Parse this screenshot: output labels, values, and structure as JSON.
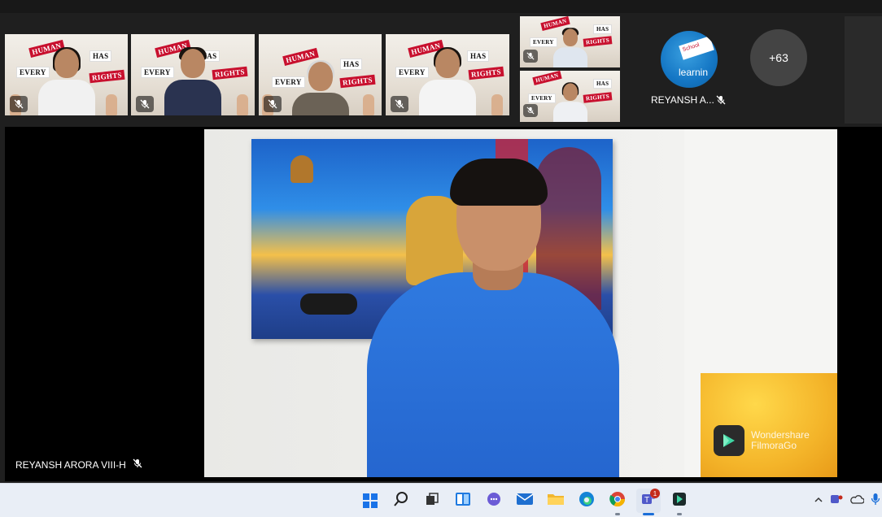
{
  "gallery": {
    "tiles": [
      {
        "sign_top": "HUMAN",
        "sign_mid": "HAS",
        "sign_left": "EVERY",
        "sign_right": "RIGHTS"
      },
      {
        "sign_top": "HUMAN",
        "sign_mid": "HAS",
        "sign_left": "EVERY",
        "sign_right": "RIGHTS"
      },
      {
        "sign_top": "HUMAN",
        "sign_mid": "HAS",
        "sign_left": "EVERY",
        "sign_right": "RIGHTS"
      },
      {
        "sign_top": "HUMAN",
        "sign_mid": "HAS",
        "sign_left": "EVERY",
        "sign_right": "RIGHTS"
      },
      {
        "sign_top": "HUMAN",
        "sign_mid": "HAS",
        "sign_left": "EVERY",
        "sign_right": "RIGHTS"
      },
      {
        "sign_top": "HUMAN",
        "sign_mid": "HAS",
        "sign_left": "EVERY",
        "sign_right": "RIGHTS"
      }
    ],
    "avatar_participant": {
      "name": "REYANSH A...",
      "avatar_text": "learnin",
      "flag_text": "School"
    },
    "overflow_count": "+63"
  },
  "stage": {
    "speaker_name": "REYANSH ARORA VIII-H",
    "watermark_line1": "Wondershare",
    "watermark_line2": "FilmoraGo"
  },
  "taskbar": {
    "teams_badge": "1"
  }
}
